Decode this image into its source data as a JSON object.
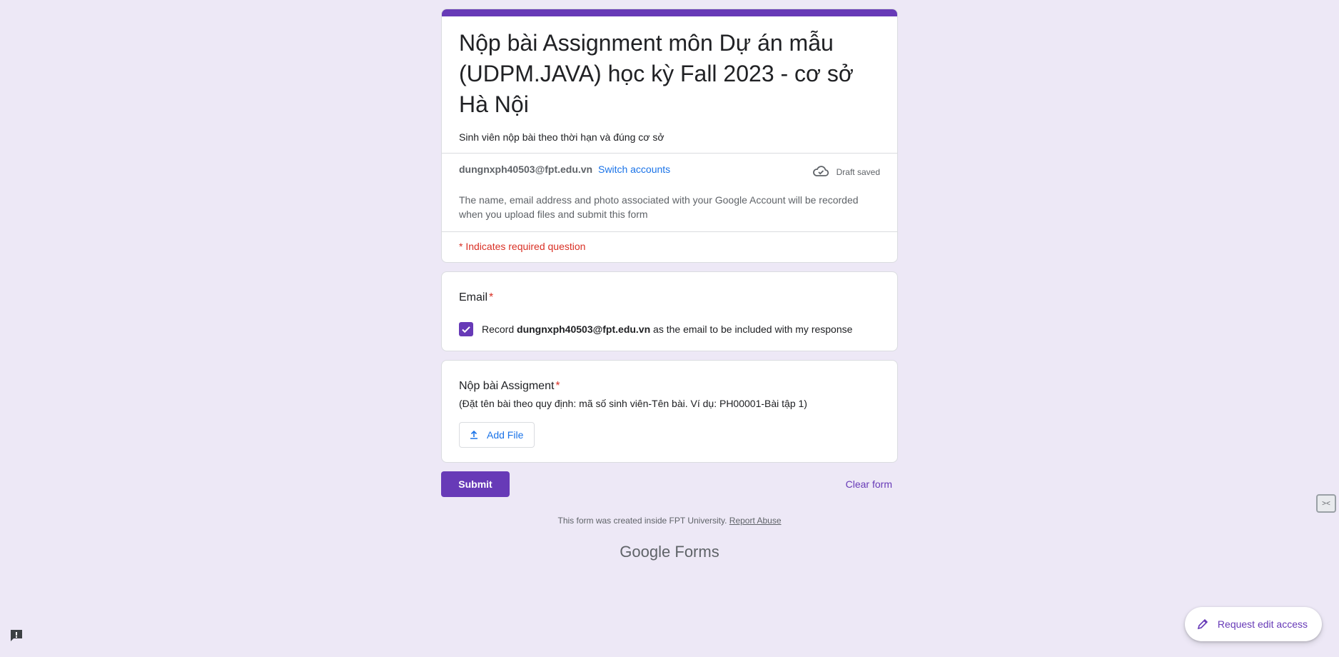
{
  "header": {
    "title": "Nộp bài Assignment môn Dự án mẫu (UDPM.JAVA) học kỳ Fall 2023 - cơ sở Hà Nội",
    "description": "Sinh viên nộp bài theo thời hạn và đúng cơ sở",
    "account_email": "dungnxph40503@fpt.edu.vn",
    "switch_accounts": "Switch accounts",
    "draft_status": "Draft saved",
    "privacy_notice": "The name, email address and photo associated with your Google Account will be recorded when you upload files and submit this form",
    "required_note": "* Indicates required question"
  },
  "questions": {
    "email": {
      "title": "Email",
      "required_mark": "*",
      "record_prefix": "Record",
      "record_email": "dungnxph40503@fpt.edu.vn",
      "record_suffix": "as the email to be included with my response",
      "checked": true
    },
    "upload": {
      "title": "Nộp bài Assigment",
      "required_mark": "*",
      "description": "(Đặt tên bài theo quy định: mã số sinh viên-Tên bài. Ví dụ: PH00001-Bài tập 1)",
      "add_file_label": "Add File"
    }
  },
  "actions": {
    "submit_label": "Submit",
    "clear_label": "Clear form"
  },
  "footer": {
    "created_text": "This form was created inside FPT University.",
    "report_link": "Report Abuse",
    "brand_google": "Google",
    "brand_forms": "Forms"
  },
  "floating": {
    "request_edit_label": "Request edit access"
  },
  "colors": {
    "accent": "#673ab7",
    "background": "#ede8f6",
    "link": "#1a73e8",
    "required": "#d93025"
  },
  "icons": [
    "cloud-check-icon",
    "check-icon",
    "upload-icon",
    "pencil-icon",
    "feedback-icon"
  ]
}
